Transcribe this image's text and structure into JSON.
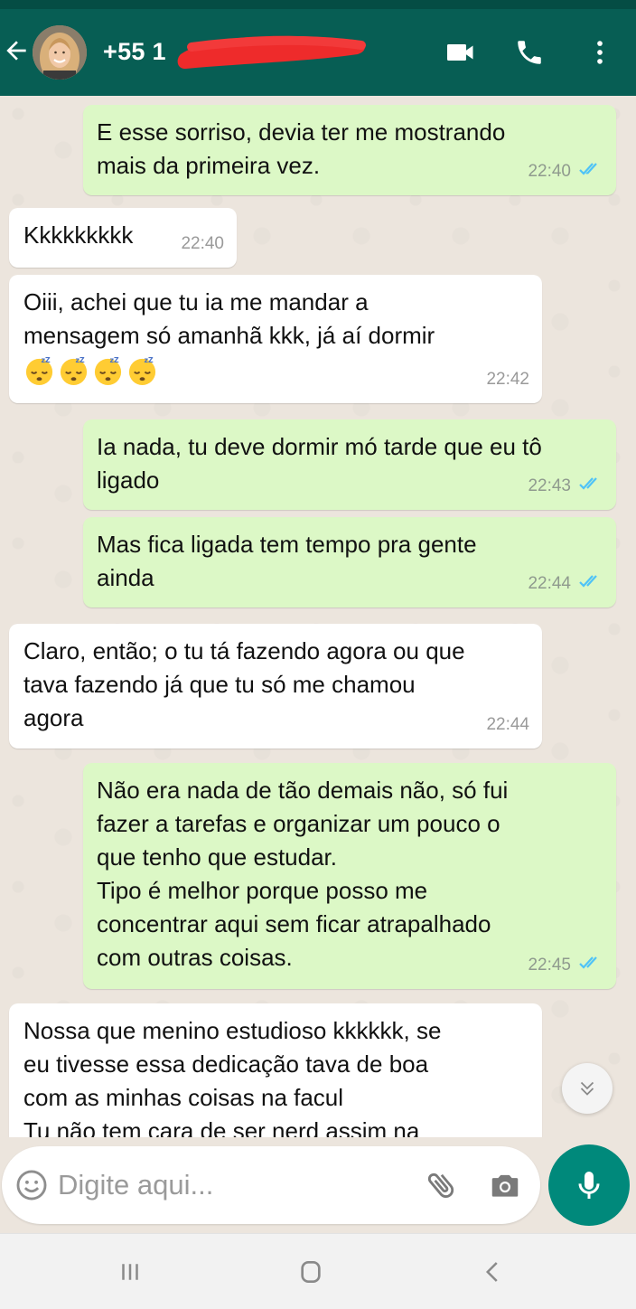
{
  "header": {
    "contact_title": "+55 1",
    "back_icon": "arrow-back-icon",
    "video_icon": "videocam-icon",
    "call_icon": "phone-icon",
    "menu_icon": "more-vert-icon"
  },
  "messages": [
    {
      "direction": "out",
      "text": "E esse sorriso, devia ter me mostrando\nmais da primeira vez.",
      "time": "22:40",
      "status": "read"
    },
    {
      "direction": "in",
      "text": "Kkkkkkkkk",
      "time": "22:40"
    },
    {
      "direction": "in",
      "text": "Oiii, achei que tu ia me mandar a\nmensagem só amanhã kkk, já aí dormir",
      "emoji": "sleeping-face-icon",
      "emoji_count": 4,
      "time": "22:42"
    },
    {
      "direction": "out",
      "text": "Ia nada, tu deve dormir mó tarde que eu tô\nligado",
      "time": "22:43",
      "status": "read"
    },
    {
      "direction": "out",
      "text": "Mas fica ligada tem tempo pra gente\nainda",
      "time": "22:44",
      "status": "read"
    },
    {
      "direction": "in",
      "text": "Claro, então; o tu tá fazendo agora ou que\ntava fazendo já que tu só me chamou\nagora",
      "time": "22:44"
    },
    {
      "direction": "out",
      "text": "Não era nada de tão demais não, só fui\nfazer a tarefas e organizar um pouco o\nque tenho que estudar.\nTipo é melhor porque posso me\nconcentrar aqui sem ficar atrapalhado\ncom outras coisas.",
      "time": "22:45",
      "status": "read"
    },
    {
      "direction": "in",
      "text": "Nossa que menino estudioso kkkkkk, se\neu tivesse essa dedicação tava de boa\ncom as minhas coisas na facul\nTu não tem cara de ser nerd assim na",
      "time": ""
    }
  ],
  "composer": {
    "placeholder": "Digite aqui...",
    "emoji_icon": "smiley-icon",
    "attach_icon": "paperclip-icon",
    "camera_icon": "camera-icon",
    "mic_icon": "microphone-icon"
  },
  "colors": {
    "header": "#075e54",
    "outgoing_bubble": "#dcf8c6",
    "incoming_bubble": "#ffffff",
    "read_ticks": "#4fc3f7",
    "mic_button": "#00897b"
  }
}
